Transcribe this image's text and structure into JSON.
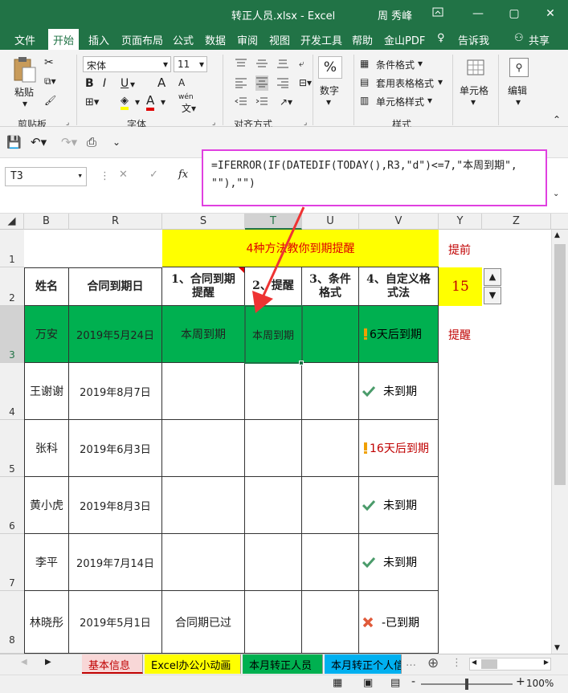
{
  "window": {
    "title": "转正人员.xlsx  -  Excel",
    "user": "周 秀峰"
  },
  "menu": {
    "tabs": [
      "文件",
      "开始",
      "插入",
      "页面布局",
      "公式",
      "数据",
      "审阅",
      "视图",
      "开发工具",
      "帮助",
      "金山PDF"
    ],
    "tell_me": "告诉我",
    "share": "共享"
  },
  "ribbon": {
    "paste": "粘贴",
    "clipboard": "剪贴板",
    "font_name": "宋体",
    "font_size": "11",
    "font_group": "字体",
    "bold": "B",
    "italic": "I",
    "underline": "U",
    "font_color_a": "A",
    "grow_a": "A",
    "shrink_a": "A",
    "wen": "wén",
    "align_group": "对齐方式",
    "number_percent": "%",
    "number": "数字",
    "cond_format": "条件格式",
    "table_format": "套用表格格式",
    "cell_style": "单元格样式",
    "styles_group": "样式",
    "cells": "单元格",
    "edit": "编辑"
  },
  "formula_bar": {
    "name_box": "T3",
    "fx": "fx",
    "line1": "=IFERROR(IF(DATEDIF(TODAY(),R3,\"d\")<=7,\"本周到期\",",
    "line2": "\"\"),\"\")"
  },
  "columns": [
    "B",
    "R",
    "S",
    "T",
    "U",
    "V",
    "Y",
    "Z"
  ],
  "rows": [
    "1",
    "2",
    "3",
    "4",
    "5",
    "6",
    "7",
    "8"
  ],
  "sheet": {
    "title": "4种方法教你到期提醒",
    "remind_label": "提前",
    "days": "15",
    "remind2": "提醒",
    "headers": [
      "姓名",
      "合同到期日",
      "1、合同到期\n提醒",
      "2、提醒",
      "3、条件\n格式",
      "4、自定义格\n式法"
    ],
    "data": [
      {
        "name": "万安",
        "date": "2019年5月24日",
        "s": "本周到期",
        "t": "本周到期",
        "u": "",
        "v": "6天后到期",
        "v_icon": "warning-icon",
        "v_color": "#000000"
      },
      {
        "name": "王谢谢",
        "date": "2019年8月7日",
        "s": "",
        "t": "",
        "u": "",
        "v": "未到期",
        "v_icon": "check-icon",
        "v_color": "#000000"
      },
      {
        "name": "张科",
        "date": "2019年6月3日",
        "s": "",
        "t": "",
        "u": "",
        "v": "16天后到期",
        "v_icon": "warning-icon",
        "v_color": "#c00000"
      },
      {
        "name": "黄小虎",
        "date": "2019年8月3日",
        "s": "",
        "t": "",
        "u": "",
        "v": "未到期",
        "v_icon": "check-icon",
        "v_color": "#000000"
      },
      {
        "name": "李平",
        "date": "2019年7月14日",
        "s": "",
        "t": "",
        "u": "",
        "v": "未到期",
        "v_icon": "check-icon",
        "v_color": "#000000"
      },
      {
        "name": "林晓彤",
        "date": "2019年5月1日",
        "s": "合同期已过",
        "t": "",
        "u": "",
        "v": "-已到期",
        "v_icon": "cross-icon",
        "v_color": "#000000"
      }
    ]
  },
  "sheet_tabs": [
    {
      "label": "基本信息",
      "bg": "#f8d7d7",
      "color": "#c00000"
    },
    {
      "label": "Excel办公小动画",
      "bg": "#ffff00",
      "color": "#000000"
    },
    {
      "label": "本月转正人员",
      "bg": "#00b050",
      "color": "#000000"
    },
    {
      "label": "本月转正个人信",
      "bg": "#00b0f0",
      "color": "#000000"
    }
  ],
  "status": {
    "zoom": "100%",
    "zoom_minus": "-",
    "zoom_plus": "+"
  },
  "colors": {
    "accent": "#217346",
    "highlight_yellow": "#ffff00",
    "green_fill": "#00b050",
    "annotation": "#e040e0",
    "arrow": "#ee3333"
  }
}
